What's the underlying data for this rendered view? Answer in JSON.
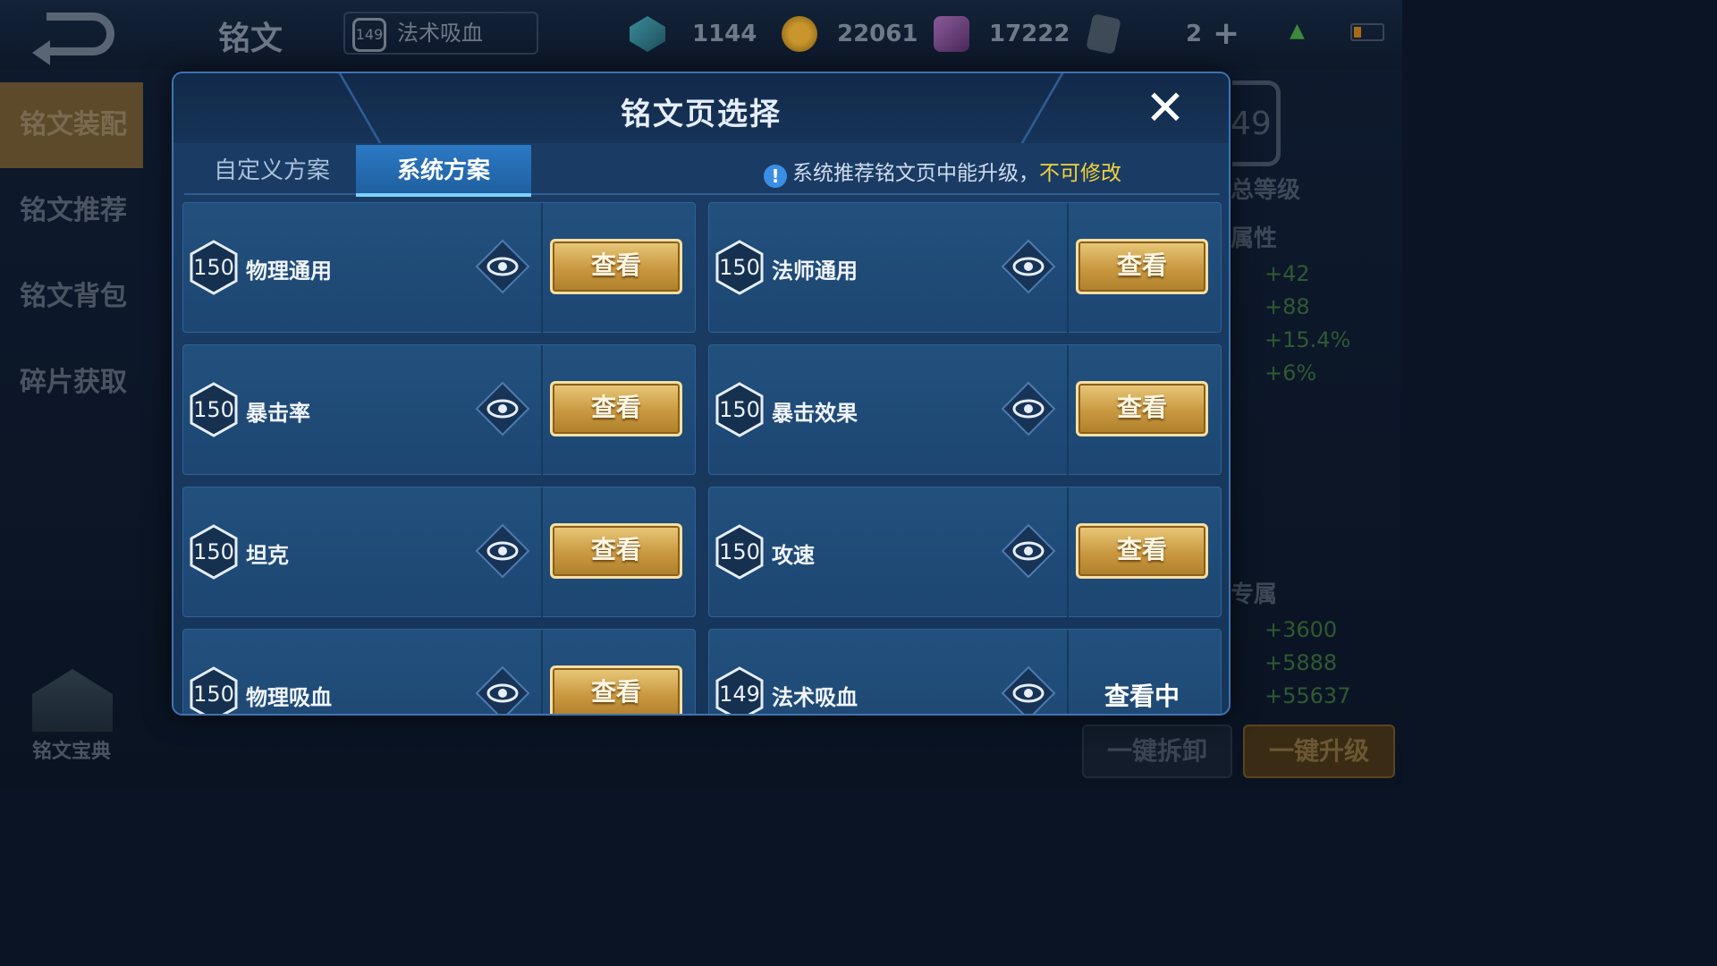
{
  "top_bar": {
    "title": "铭文",
    "current_page": {
      "level": "149",
      "name": "法术吸血"
    },
    "currencies": [
      {
        "icon": "gem-crystal-icon",
        "value": "1144"
      },
      {
        "icon": "gold-coin-icon",
        "value": "22061"
      },
      {
        "icon": "purple-crystal-icon",
        "value": "17222"
      },
      {
        "icon": "card-ticket-icon",
        "value": "2"
      }
    ]
  },
  "sidebar": {
    "items": [
      {
        "label": "铭文装配",
        "active": true
      },
      {
        "label": "铭文推荐",
        "active": false
      },
      {
        "label": "铭文背包",
        "active": false
      },
      {
        "label": "碎片获取",
        "active": false
      }
    ],
    "book_label": "铭文宝典"
  },
  "right_panel": {
    "level": "49",
    "total_label": "总等级",
    "attr_label": "属性",
    "attr_values": [
      "+42",
      "+88",
      "+15.4%",
      "+6%"
    ],
    "exclusive_label": "专属",
    "exclusive_values": [
      "+3600",
      "+5888",
      "+55637"
    ],
    "btn_disassemble": "一键拆卸",
    "btn_upgrade": "一键升级"
  },
  "modal": {
    "title": "铭文页选择",
    "tabs": [
      {
        "label": "自定义方案",
        "active": false
      },
      {
        "label": "系统方案",
        "active": true
      }
    ],
    "notice": {
      "text": "系统推荐铭文页中能升级，",
      "highlight": "不可修改"
    },
    "view_label": "查看",
    "viewing_label": "查看中",
    "pages": [
      {
        "level": "150",
        "name": "物理通用"
      },
      {
        "level": "150",
        "name": "法师通用"
      },
      {
        "level": "150",
        "name": "暴击率"
      },
      {
        "level": "150",
        "name": "暴击效果"
      },
      {
        "level": "150",
        "name": "坦克"
      },
      {
        "level": "150",
        "name": "攻速"
      },
      {
        "level": "150",
        "name": "物理吸血"
      },
      {
        "level": "149",
        "name": "法术吸血"
      }
    ]
  }
}
